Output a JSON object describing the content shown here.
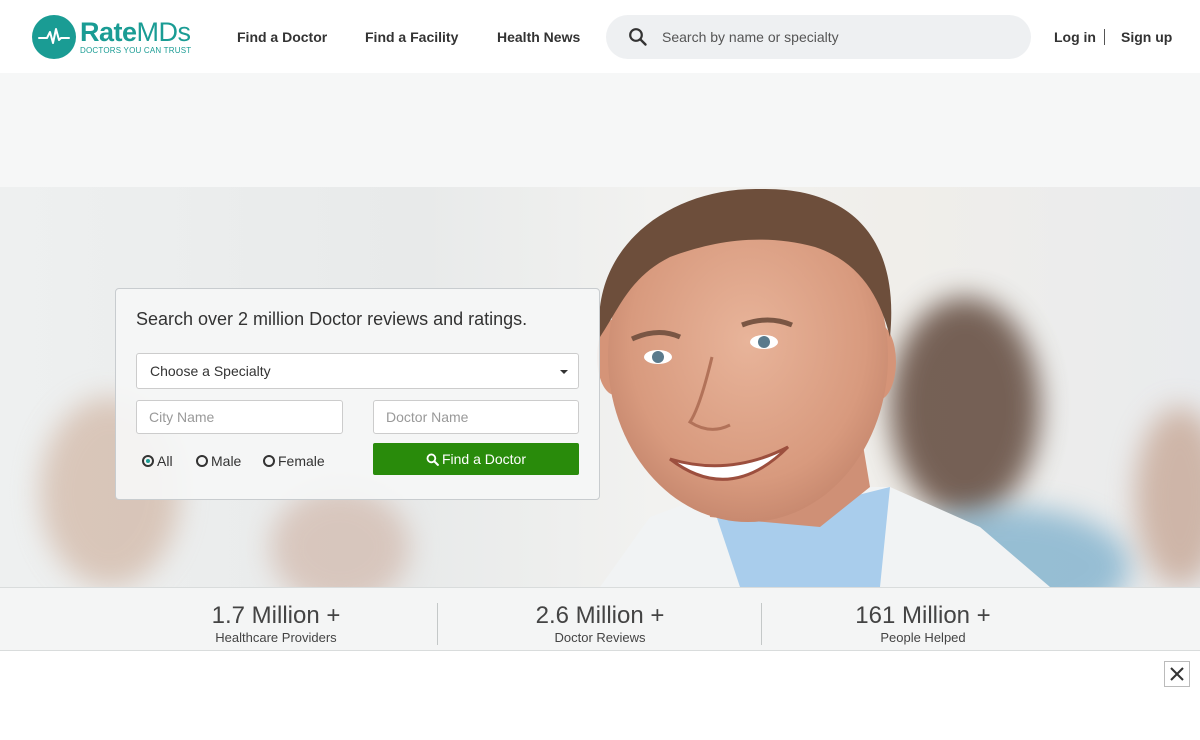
{
  "header": {
    "logo_name_part1": "Rate",
    "logo_name_part2": "MDs",
    "logo_tagline": "DOCTORS YOU CAN TRUST",
    "nav": {
      "find_doctor": "Find a Doctor",
      "find_facility": "Find a Facility",
      "health_news": "Health News"
    },
    "search": {
      "placeholder": "Search by name or specialty"
    },
    "login": "Log in",
    "signup": "Sign up"
  },
  "search_card": {
    "title": "Search over 2 million Doctor reviews and ratings.",
    "specialty_selected": "Choose a Specialty",
    "city_placeholder": "City Name",
    "doctor_placeholder": "Doctor Name",
    "gender_options": [
      "All",
      "Male",
      "Female"
    ],
    "gender_selected": "All",
    "find_button": "Find a Doctor"
  },
  "stats": [
    {
      "value": "1.7 Million +",
      "label": "Healthcare Providers"
    },
    {
      "value": "2.6 Million +",
      "label": "Doctor Reviews"
    },
    {
      "value": "161 Million +",
      "label": "People Helped"
    }
  ],
  "colors": {
    "brand_teal": "#1a9c94",
    "button_green": "#298b0b"
  }
}
